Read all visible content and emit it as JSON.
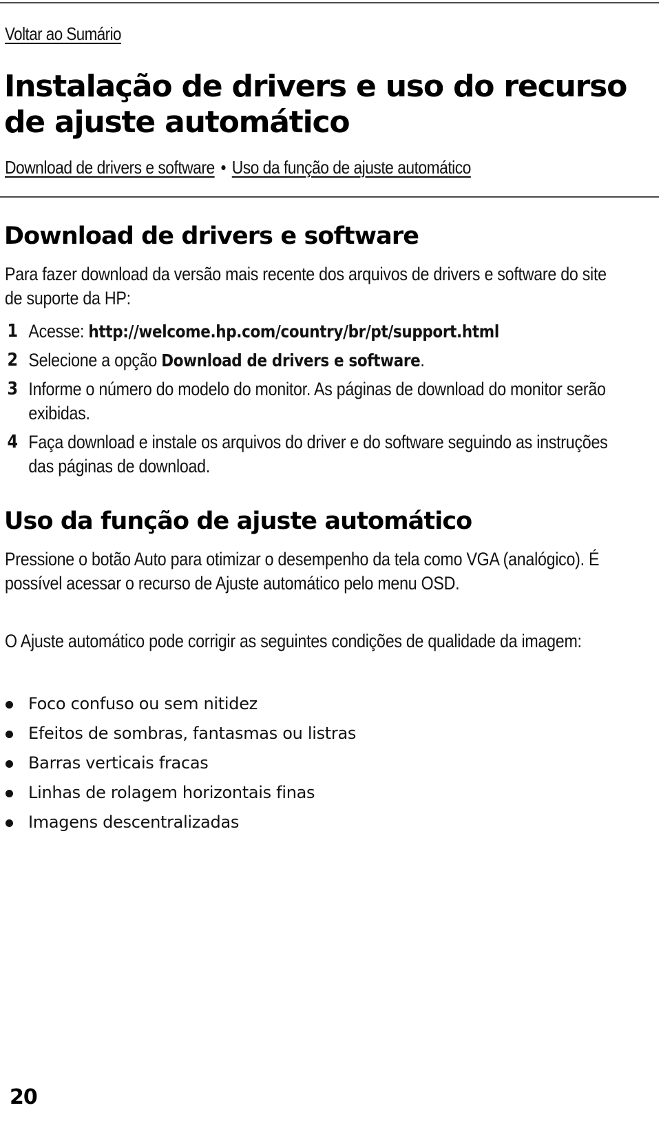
{
  "nav": {
    "back_link": "Voltar ao Sumário"
  },
  "page": {
    "title": "Instalação de drivers e uso do recurso de ajuste automático",
    "toc": [
      {
        "label": "Download de drivers e software"
      },
      {
        "label": "Uso da função de ajuste automático"
      }
    ],
    "toc_separator": "•",
    "page_number": "20"
  },
  "section_download": {
    "heading": "Download de drivers e software",
    "intro": "Para fazer download da versão mais recente dos arquivos de drivers e software do site de suporte da HP:",
    "steps": [
      {
        "num": "1",
        "text": "Acesse: ",
        "bold": "http://welcome.hp.com/country/br/pt/support.html",
        "after": ""
      },
      {
        "num": "2",
        "text": "Selecione a opção ",
        "bold": "Download de drivers e software",
        "after": "."
      },
      {
        "num": "3",
        "text": "Informe o número do modelo do monitor. As páginas de download do monitor serão exibidas.",
        "bold": "",
        "after": ""
      },
      {
        "num": "4",
        "text": "Faça download e instale os arquivos do driver e do software seguindo as instruções das páginas de download.",
        "bold": "",
        "after": ""
      }
    ]
  },
  "section_auto": {
    "heading": "Uso da função de ajuste automático",
    "para1": "Pressione o botão Auto para otimizar o desempenho da tela como VGA (analógico). É possível acessar o recurso de Ajuste automático pelo menu OSD.",
    "para2": "O Ajuste automático pode corrigir as seguintes condições de qualidade da imagem:",
    "bullets": [
      "Foco confuso ou sem nitidez",
      "Efeitos de sombras, fantasmas ou listras",
      "Barras verticais fracas",
      "Linhas de rolagem horizontais finas",
      "Imagens descentralizadas"
    ]
  }
}
